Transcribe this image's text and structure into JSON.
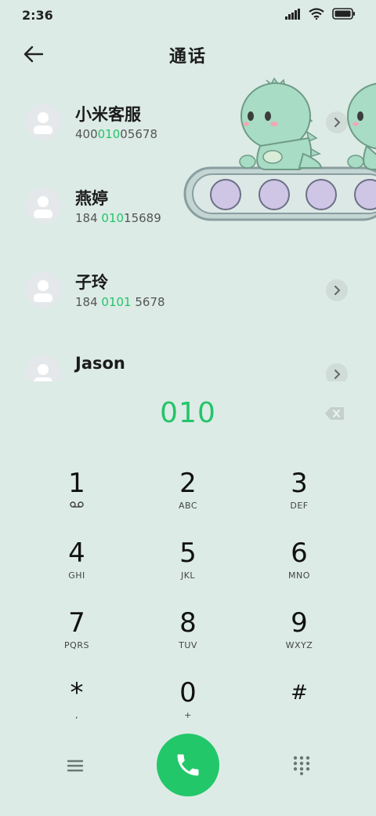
{
  "status_bar": {
    "time": "2:36"
  },
  "header": {
    "title": "通话"
  },
  "contacts": [
    {
      "name": "小米客服",
      "number_parts": [
        "400",
        "010",
        "05678"
      ]
    },
    {
      "name": "燕婷",
      "number_parts": [
        "184 ",
        "010",
        "15689"
      ]
    },
    {
      "name": "子玲",
      "number_parts": [
        "184 ",
        "0101",
        " 5678"
      ]
    },
    {
      "name": "Jason",
      "number_parts": [
        "",
        "",
        ""
      ]
    }
  ],
  "dialer": {
    "input": "010"
  },
  "keypad": [
    {
      "digit": "1",
      "letters": ""
    },
    {
      "digit": "2",
      "letters": "ABC"
    },
    {
      "digit": "3",
      "letters": "DEF"
    },
    {
      "digit": "4",
      "letters": "GHI"
    },
    {
      "digit": "5",
      "letters": "JKL"
    },
    {
      "digit": "6",
      "letters": "MNO"
    },
    {
      "digit": "7",
      "letters": "PQRS"
    },
    {
      "digit": "8",
      "letters": "TUV"
    },
    {
      "digit": "9",
      "letters": "WXYZ"
    },
    {
      "digit": "*",
      "letters": ","
    },
    {
      "digit": "0",
      "letters": "+"
    },
    {
      "digit": "#",
      "letters": ""
    }
  ],
  "icons": {
    "back": "arrow-left-icon",
    "detail": "chevron-right-icon",
    "backspace": "backspace-icon",
    "voicemail": "voicemail-icon",
    "menu": "menu-icon",
    "call": "phone-icon",
    "dialpad": "dialpad-icon"
  },
  "colors": {
    "background": "#dcebe5",
    "accent": "#23c46a",
    "call_button": "#22c76a"
  }
}
